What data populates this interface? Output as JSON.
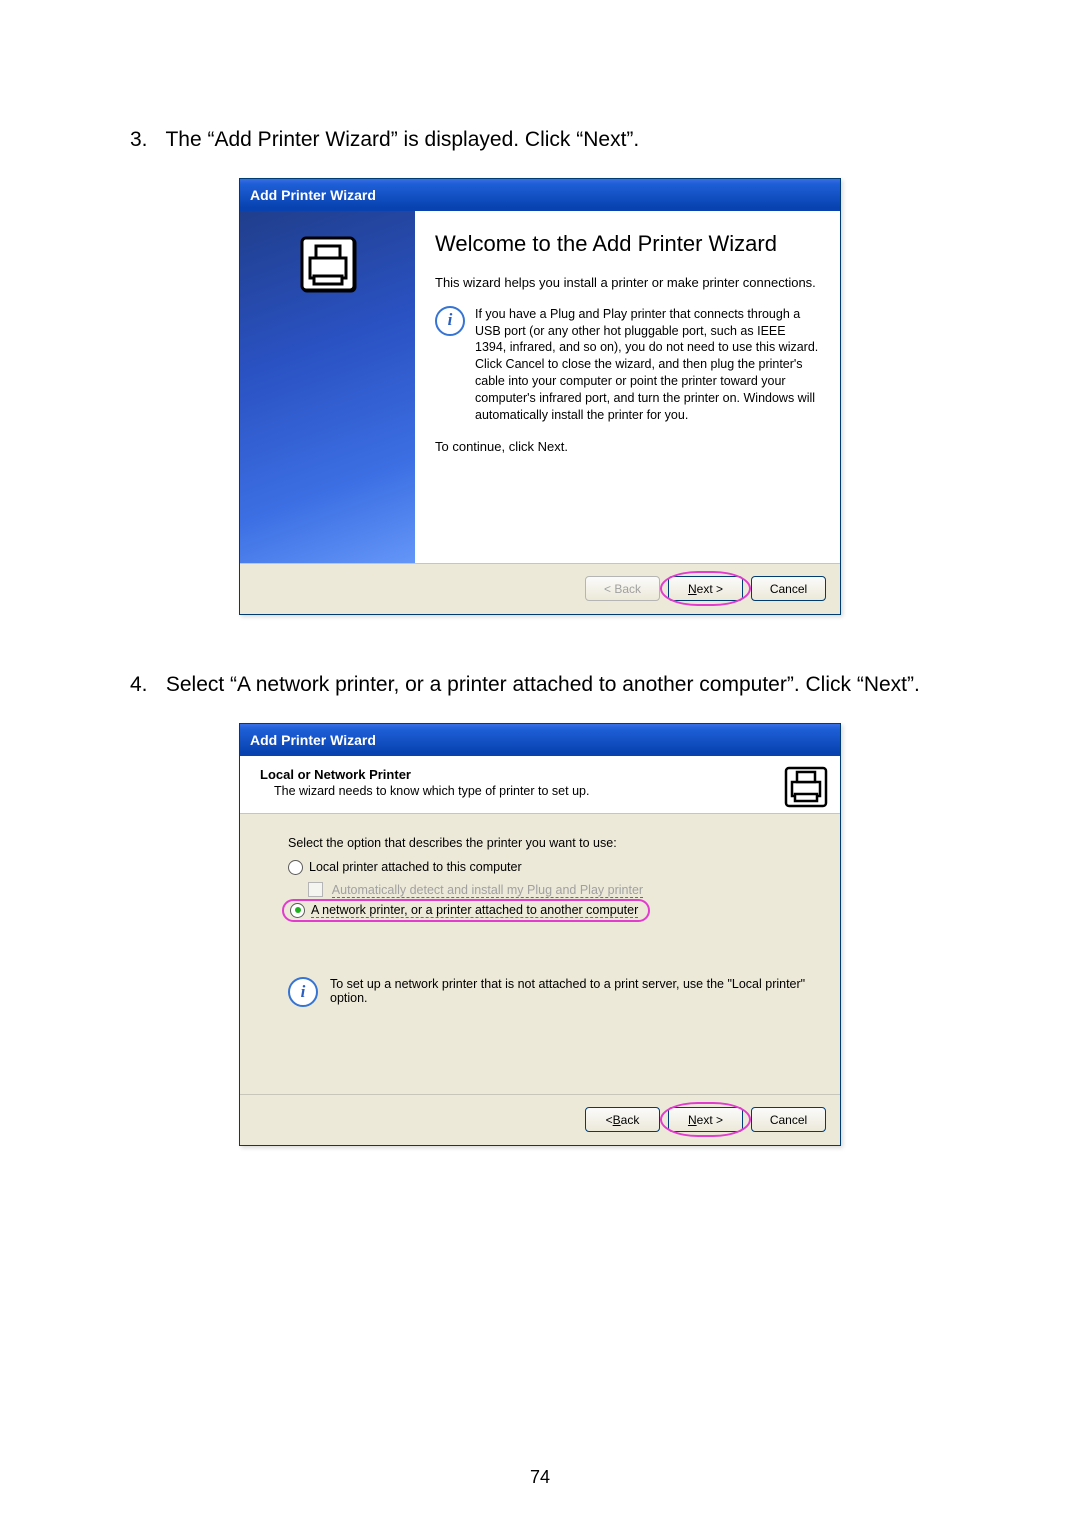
{
  "steps": {
    "s3": {
      "num": "3.",
      "text": "The “Add Printer Wizard” is displayed. Click “Next”."
    },
    "s4": {
      "num": "4.",
      "text": "Select “A network printer, or a printer attached to another computer”. Click “Next”."
    }
  },
  "wiz1": {
    "title": "Add Printer Wizard",
    "heading": "Welcome to the Add Printer Wizard",
    "intro": "This wizard helps you install a printer or make printer connections.",
    "info": "If you have a Plug and Play printer that connects through a USB port (or any other hot pluggable port, such as IEEE 1394, infrared, and so on), you do not need to use this wizard. Click Cancel to close the wizard, and then plug the printer's cable into your computer or point the printer toward your computer's infrared port, and turn the printer on. Windows will automatically install the printer for you.",
    "continue": "To continue, click Next.",
    "buttons": {
      "back": "< Back",
      "next": "Next >",
      "cancel": "Cancel"
    }
  },
  "wiz2": {
    "title": "Add Printer Wizard",
    "header_title": "Local or Network Printer",
    "header_sub": "The wizard needs to know which type of printer to set up.",
    "lead": "Select the option that describes the printer you want to use:",
    "opt_local": "Local printer attached to this computer",
    "opt_autodetect": "Automatically detect and install my Plug and Play printer",
    "opt_network": "A network printer, or a printer attached to another computer",
    "info": "To set up a network printer that is not attached to a print server, use the \"Local printer\" option.",
    "buttons": {
      "back": "< Back",
      "next": "Next >",
      "cancel": "Cancel"
    }
  },
  "pagenum": "74"
}
